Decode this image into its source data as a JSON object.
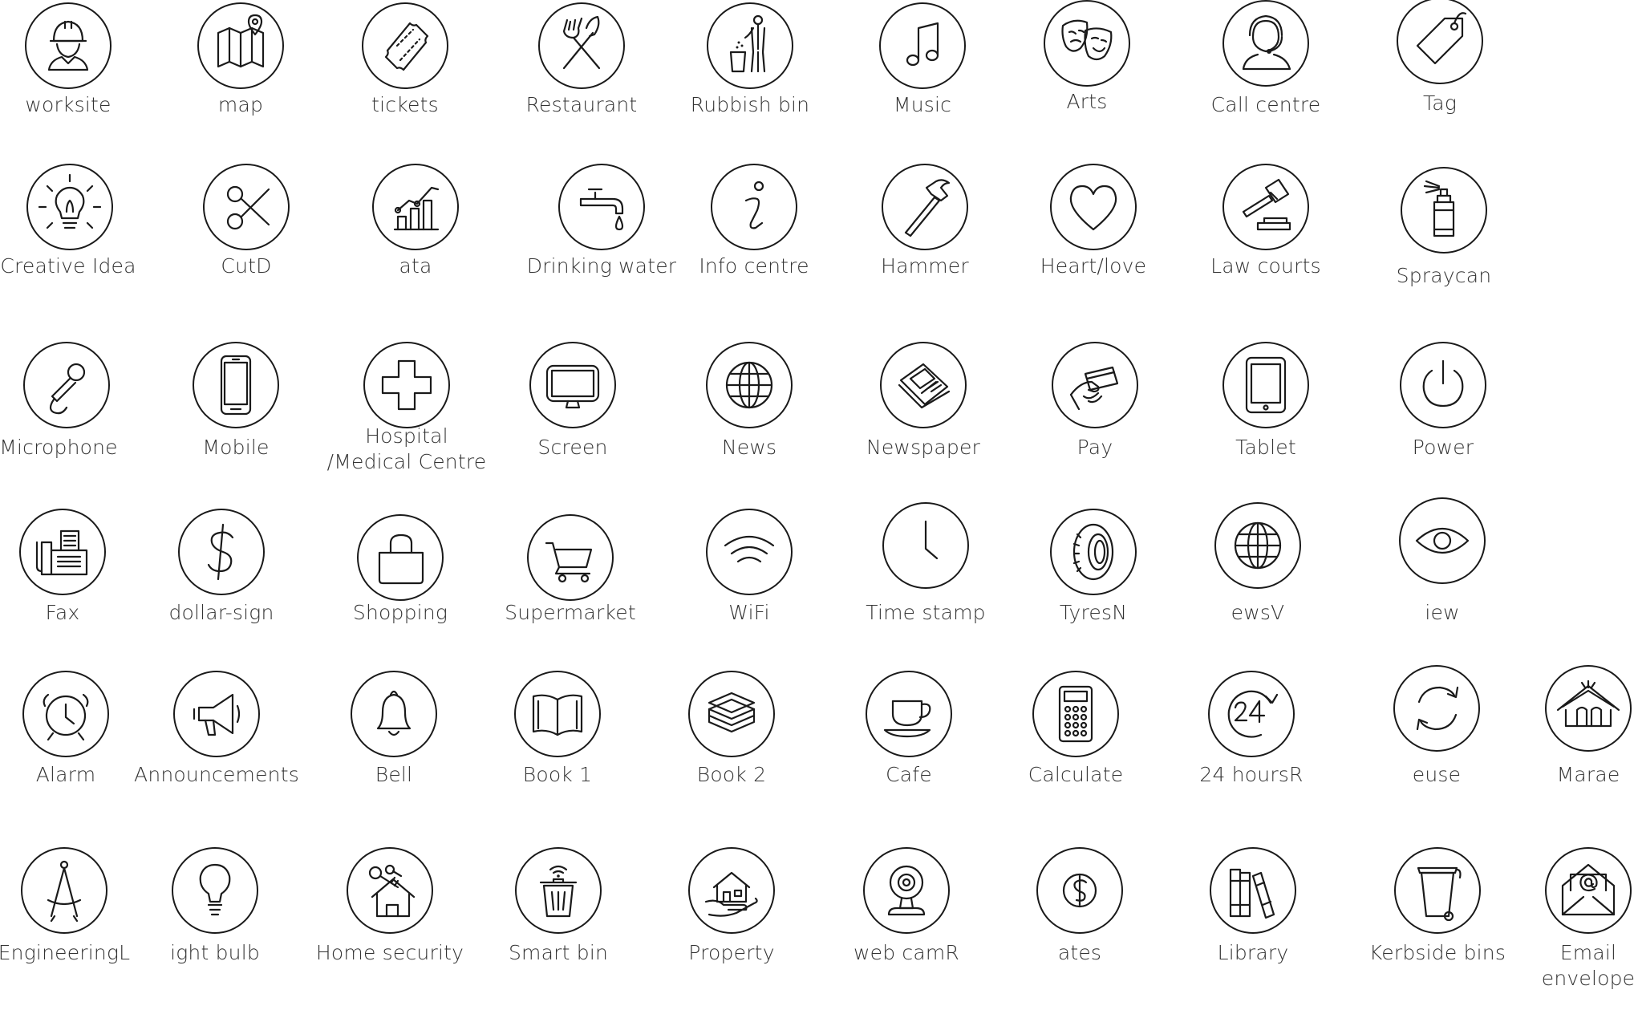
{
  "colors": {
    "stroke": "#1a1a1a",
    "label": "#333333",
    "background": "#ffffff"
  },
  "icons": [
    {
      "label": "worksite",
      "icon": "worksite-icon"
    },
    {
      "label": "map",
      "icon": "map-icon"
    },
    {
      "label": "tickets",
      "icon": "tickets-icon"
    },
    {
      "label": "Restaurant",
      "icon": "restaurant-icon"
    },
    {
      "label": "Rubbish bin",
      "icon": "rubbish-bin-icon"
    },
    {
      "label": "Music",
      "icon": "music-icon"
    },
    {
      "label": "Arts",
      "icon": "arts-icon"
    },
    {
      "label": "Call centre",
      "icon": "call-centre-icon"
    },
    {
      "label": "Tag",
      "icon": "tag-icon"
    },
    {
      "label": "Creative Idea",
      "icon": "creative-idea-icon"
    },
    {
      "label": "CutD",
      "icon": "cut-icon"
    },
    {
      "label": "ata",
      "icon": "data-icon"
    },
    {
      "label": "Drinking water",
      "icon": "drinking-water-icon"
    },
    {
      "label": "Info centre",
      "icon": "info-centre-icon"
    },
    {
      "label": "Hammer",
      "icon": "hammer-icon"
    },
    {
      "label": "Heart/love",
      "icon": "heart-icon"
    },
    {
      "label": "Law courts",
      "icon": "law-courts-icon"
    },
    {
      "label": "Spraycan",
      "icon": "spraycan-icon"
    },
    {
      "label": "Microphone",
      "icon": "microphone-icon"
    },
    {
      "label": "Mobile",
      "icon": "mobile-icon"
    },
    {
      "label": "Hospital\n/Medical Centre",
      "icon": "hospital-icon"
    },
    {
      "label": "Screen",
      "icon": "screen-icon"
    },
    {
      "label": "News",
      "icon": "news-globe-icon"
    },
    {
      "label": "Newspaper",
      "icon": "newspaper-icon"
    },
    {
      "label": "Pay",
      "icon": "pay-icon"
    },
    {
      "label": "Tablet",
      "icon": "tablet-icon"
    },
    {
      "label": "Power",
      "icon": "power-icon"
    },
    {
      "label": "Fax",
      "icon": "fax-icon"
    },
    {
      "label": "dollar-sign",
      "icon": "dollar-sign-icon"
    },
    {
      "label": "Shopping",
      "icon": "shopping-bag-icon"
    },
    {
      "label": "Supermarket",
      "icon": "supermarket-cart-icon"
    },
    {
      "label": "WiFi",
      "icon": "wifi-icon"
    },
    {
      "label": "Time stamp",
      "icon": "clock-icon"
    },
    {
      "label": "TyresN",
      "icon": "tyres-icon"
    },
    {
      "label": "ewsV",
      "icon": "news-globe-icon"
    },
    {
      "label": "iew",
      "icon": "view-eye-icon"
    },
    {
      "label": "Alarm",
      "icon": "alarm-icon"
    },
    {
      "label": "Announcements",
      "icon": "megaphone-icon"
    },
    {
      "label": "Bell",
      "icon": "bell-icon"
    },
    {
      "label": "Book 1",
      "icon": "open-book-icon"
    },
    {
      "label": "Book 2",
      "icon": "book-stack-icon"
    },
    {
      "label": "Cafe",
      "icon": "cafe-cup-icon"
    },
    {
      "label": "Calculate",
      "icon": "calculator-icon"
    },
    {
      "label": "24 hoursR",
      "icon": "24-hours-icon"
    },
    {
      "label": "euse",
      "icon": "reuse-icon"
    },
    {
      "label": "Marae",
      "icon": "marae-icon"
    },
    {
      "label": "EngineeringL",
      "icon": "engineering-compass-icon"
    },
    {
      "label": "ight bulb",
      "icon": "light-bulb-icon"
    },
    {
      "label": "Home security",
      "icon": "home-security-icon"
    },
    {
      "label": "Smart bin",
      "icon": "smart-bin-icon"
    },
    {
      "label": "Property",
      "icon": "property-icon"
    },
    {
      "label": "web camR",
      "icon": "web-cam-icon"
    },
    {
      "label": "ates",
      "icon": "rates-icon"
    },
    {
      "label": "Library",
      "icon": "library-icon"
    },
    {
      "label": "Kerbside bins",
      "icon": "kerbside-bin-icon"
    },
    {
      "label": "Email\nenvelope",
      "icon": "email-envelope-icon"
    }
  ]
}
